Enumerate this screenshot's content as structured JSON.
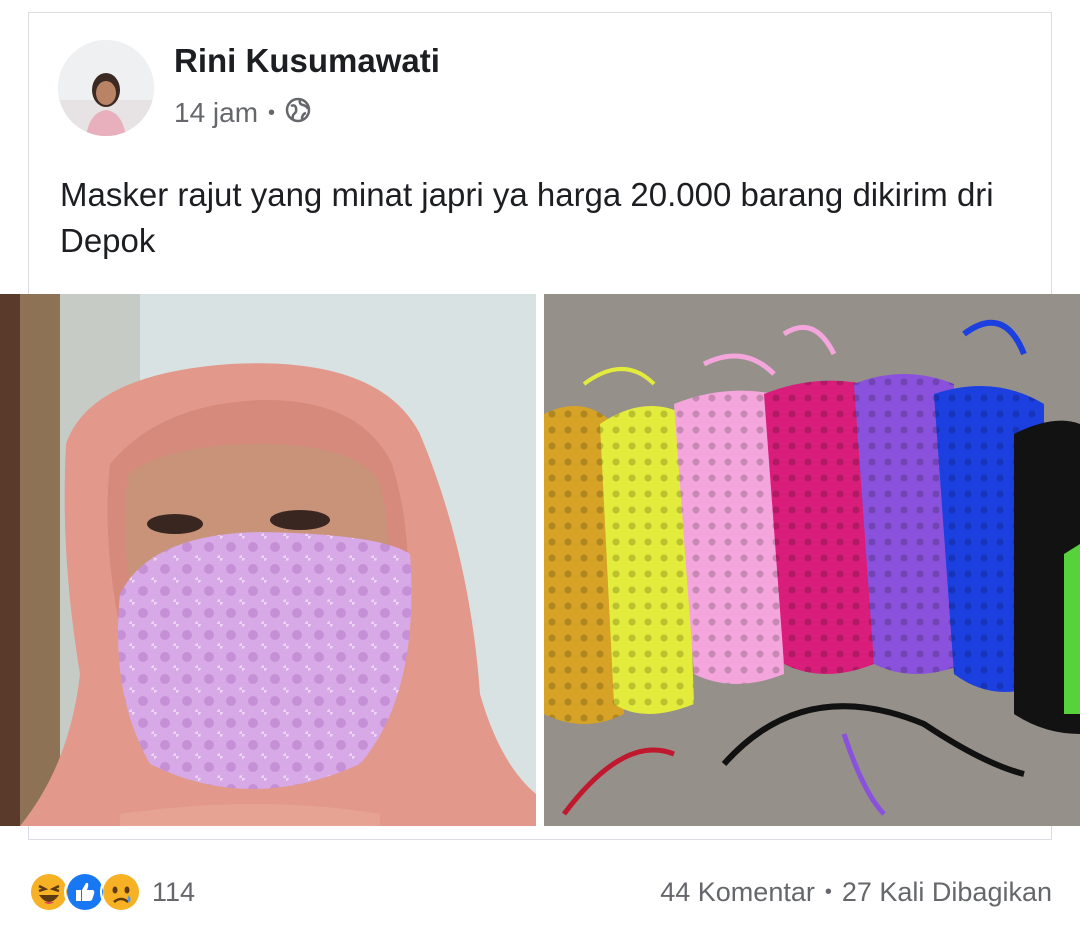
{
  "post": {
    "author": "Rini Kusumawati",
    "time": "14 jam",
    "separator": "•",
    "privacy_icon": "globe-icon",
    "text": "Masker rajut yang minat japri ya harga 20.000 barang dikirim dri Depok"
  },
  "footer": {
    "reaction_icons": [
      "haha-emoji-icon",
      "like-icon",
      "sad-emoji-icon"
    ],
    "reaction_count": "114",
    "comments": "44 Komentar",
    "separator": "•",
    "shares": "27 Kali Dibagikan"
  },
  "colors": {
    "text_primary": "#1c1e21",
    "text_secondary": "#65676b",
    "like_blue": "#1877f2",
    "emoji_yellow": "#f7b125"
  }
}
